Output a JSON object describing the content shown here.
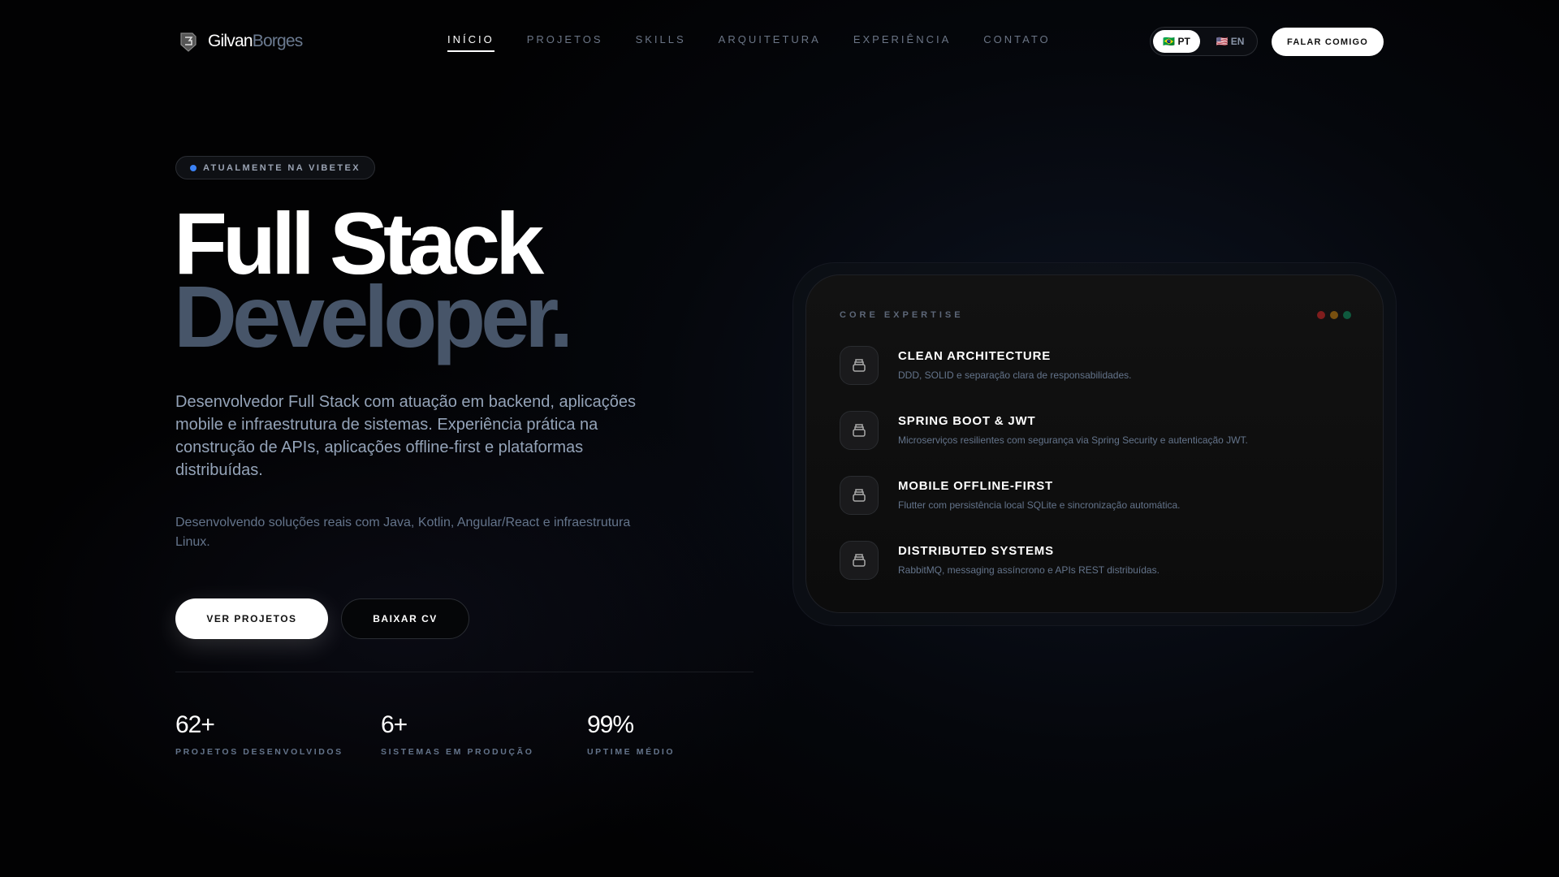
{
  "brand": {
    "first": "Gilvan",
    "last": "Borges"
  },
  "nav": [
    {
      "label": "INÍCIO"
    },
    {
      "label": "PROJETOS"
    },
    {
      "label": "SKILLS"
    },
    {
      "label": "ARQUITETURA"
    },
    {
      "label": "EXPERIÊNCIA"
    },
    {
      "label": "CONTATO"
    }
  ],
  "lang": {
    "pt": "🇧🇷 PT",
    "en": "🇺🇸 EN"
  },
  "cta": "FALAR COMIGO",
  "hero": {
    "badge": "ATUALMENTE NA VIBETEX",
    "title1": "Full Stack",
    "title2": "Developer.",
    "p1": "Desenvolvedor Full Stack com atuação em backend, aplicações mobile e infraestrutura de sistemas. Experiência prática na construção de APIs, aplicações offline-first e plataformas distribuídas.",
    "p2": "Desenvolvendo soluções reais com Java, Kotlin, Angular/React e infraestrutura Linux.",
    "btn_projects": "VER PROJETOS",
    "btn_cv": "BAIXAR CV"
  },
  "stats": [
    {
      "value": "62+",
      "label": "PROJETOS DESENVOLVIDOS"
    },
    {
      "value": "6+",
      "label": "SISTEMAS EM PRODUÇÃO"
    },
    {
      "value": "99%",
      "label": "UPTIME MÉDIO"
    }
  ],
  "card": {
    "label": "CORE EXPERTISE",
    "dot_colors": [
      "#7f1d1d",
      "#78500f",
      "#0f5a3e"
    ],
    "items": [
      {
        "title": "CLEAN ARCHITECTURE",
        "desc": "DDD, SOLID e separação clara de responsabilidades."
      },
      {
        "title": "SPRING BOOT & JWT",
        "desc": "Microserviços resilientes com segurança via Spring Security e autenticação JWT."
      },
      {
        "title": "MOBILE OFFLINE-FIRST",
        "desc": "Flutter com persistência local SQLite e sincronização automática."
      },
      {
        "title": "DISTRIBUTED SYSTEMS",
        "desc": "RabbitMQ, messaging assíncrono e APIs REST distribuídas."
      }
    ]
  }
}
